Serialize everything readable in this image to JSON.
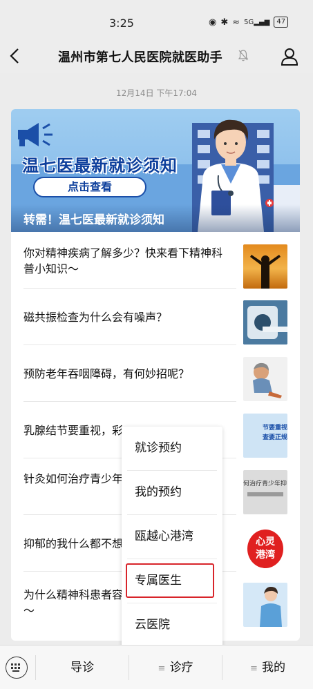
{
  "status_bar": {
    "time": "3:25",
    "signal_text": "5G",
    "battery": "47"
  },
  "nav": {
    "title": "温州市第七人民医院就医助手"
  },
  "timestamp": "12月14日 下午17:04",
  "banner": {
    "headline": "温七医最新就诊须知",
    "button": "点击查看",
    "caption": "转需！温七医最新就诊须知"
  },
  "articles": [
    {
      "title": "你对精神疾病了解多少？快来看下精神科普小知识～"
    },
    {
      "title": "磁共振检查为什么会有噪声？"
    },
    {
      "title": "预防老年吞咽障碍，有何妙招呢？"
    },
    {
      "title": "乳腺结节要重视，彩"
    },
    {
      "title": "针灸如何治疗青少年抑郁？招募志愿者"
    },
    {
      "title": "抑郁的我什么都不想"
    },
    {
      "title": "为什么精神科患者容易便秘？该如何护理～"
    }
  ],
  "thumbs": {
    "breast_lines": [
      "节要重视",
      "查要正规"
    ],
    "acupuncture": "何治疗青少年抑",
    "heart_logo": [
      "心灵",
      "港湾"
    ]
  },
  "popup_menu": {
    "items": [
      "就诊预约",
      "我的预约",
      "瓯越心港湾",
      "专属医生",
      "云医院"
    ],
    "highlighted_index": 3
  },
  "bottom_menu": {
    "tabs": [
      "导诊",
      "诊疗",
      "我的"
    ]
  },
  "colors": {
    "highlight": "#d8242a",
    "banner_blue": "#0d3f9c"
  }
}
